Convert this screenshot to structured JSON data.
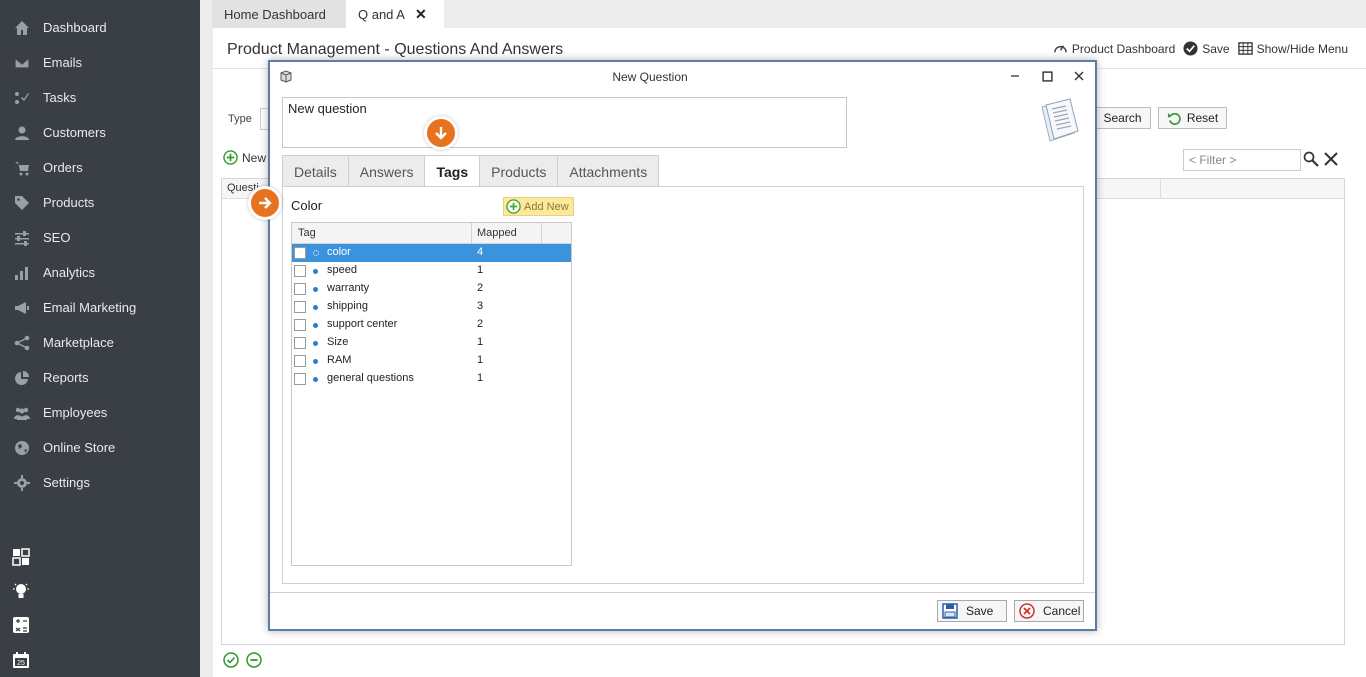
{
  "sidebar": {
    "items": [
      {
        "label": "Dashboard",
        "icon": "home-icon"
      },
      {
        "label": "Emails",
        "icon": "mail-icon"
      },
      {
        "label": "Tasks",
        "icon": "tasks-icon"
      },
      {
        "label": "Customers",
        "icon": "person-icon"
      },
      {
        "label": "Orders",
        "icon": "cart-icon"
      },
      {
        "label": "Products",
        "icon": "tag-icon"
      },
      {
        "label": "SEO",
        "icon": "sliders-icon"
      },
      {
        "label": "Analytics",
        "icon": "bar-chart-icon"
      },
      {
        "label": "Email Marketing",
        "icon": "megaphone-icon"
      },
      {
        "label": "Marketplace",
        "icon": "share-icon"
      },
      {
        "label": "Reports",
        "icon": "pie-chart-icon"
      },
      {
        "label": "Employees",
        "icon": "group-icon"
      },
      {
        "label": "Online Store",
        "icon": "globe-icon"
      },
      {
        "label": "Settings",
        "icon": "gear-icon"
      }
    ]
  },
  "tabs": {
    "home": "Home Dashboard",
    "qa": "Q and A"
  },
  "page": {
    "title": "Product Management - Questions And Answers",
    "toolbar": {
      "product_dashboard": "Product Dashboard",
      "save": "Save",
      "show_hide_menu": "Show/Hide Menu"
    },
    "type_label": "Type",
    "search_label": "Search",
    "reset_label": "Reset",
    "new_label": "New",
    "filter_placeholder": "< Filter >",
    "grid_header": "Questi"
  },
  "dialog": {
    "title": "New Question",
    "question_text": "New question",
    "tabs": [
      "Details",
      "Answers",
      "Tags",
      "Products",
      "Attachments"
    ],
    "active_tab": "Tags",
    "tag_input_value": "Color",
    "add_new_label": "Add New",
    "columns": {
      "tag": "Tag",
      "mapped": "Mapped"
    },
    "rows": [
      {
        "tag": "color",
        "mapped": "4"
      },
      {
        "tag": "speed",
        "mapped": "1"
      },
      {
        "tag": "warranty",
        "mapped": "2"
      },
      {
        "tag": "shipping",
        "mapped": "3"
      },
      {
        "tag": "support center",
        "mapped": "2"
      },
      {
        "tag": "Size",
        "mapped": "1"
      },
      {
        "tag": "RAM",
        "mapped": "1"
      },
      {
        "tag": "general questions",
        "mapped": "1"
      }
    ],
    "save_label": "Save",
    "cancel_label": "Cancel"
  },
  "colors": {
    "sidebar_bg": "#3a3f45",
    "accent_orange": "#e8731f",
    "selection_blue": "#3b93de",
    "dialog_border": "#5b7fa3"
  }
}
